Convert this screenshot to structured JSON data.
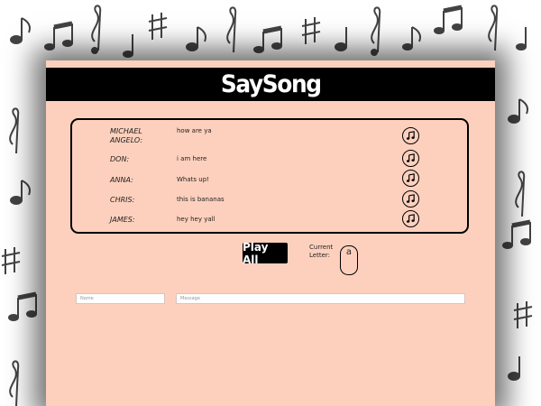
{
  "app": {
    "title": "SaySong"
  },
  "messages": [
    {
      "name": "MICHAEL ANGELO:",
      "text": "how are ya"
    },
    {
      "name": "DON:",
      "text": "i am here"
    },
    {
      "name": "ANNA:",
      "text": "Whats up!"
    },
    {
      "name": "CHRIS:",
      "text": "this is bananas"
    },
    {
      "name": "JAMES:",
      "text": "hey hey yall"
    }
  ],
  "controls": {
    "play_all_label": "Play All",
    "current_letter_label": "Current Letter:",
    "current_letter": "a"
  },
  "form": {
    "name_placeholder": "Name",
    "message_placeholder": "Message"
  },
  "icons": {
    "play_row": "music-note-icon",
    "background": "music-notes-pattern"
  },
  "colors": {
    "card_bg": "#fdd0bd",
    "header_bg": "#000000",
    "title": "#ffffff",
    "play_all_bg": "#000000"
  }
}
